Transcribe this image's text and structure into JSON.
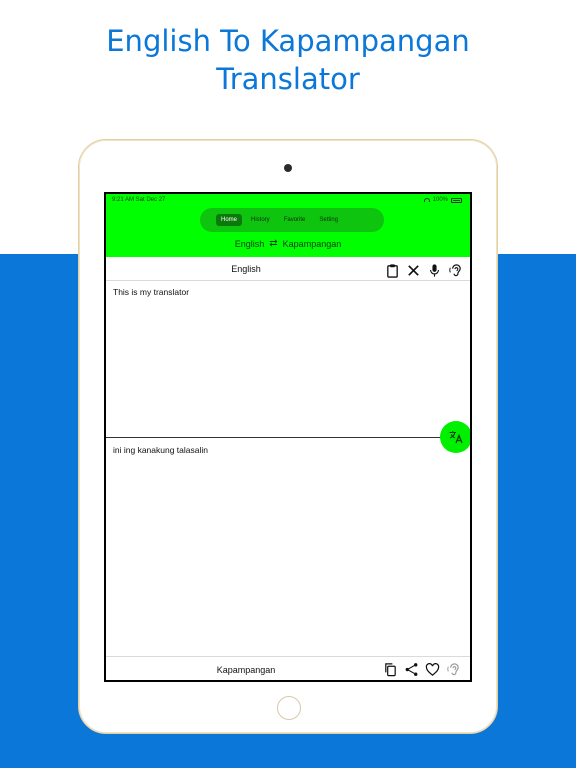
{
  "headline": {
    "line1": "English To Kapampangan",
    "line2": "Translator"
  },
  "status_bar": {
    "time_date": "9:21 AM   Sat Dec 27",
    "battery": "100%"
  },
  "nav_tabs": [
    {
      "label": "Home",
      "active": true
    },
    {
      "label": "History",
      "active": false
    },
    {
      "label": "Favorite",
      "active": false
    },
    {
      "label": "Setting",
      "active": false
    }
  ],
  "languages": {
    "source": "English",
    "swap_icon": "swap-arrows-icon",
    "target": "Kapampangan"
  },
  "source_panel": {
    "title": "English",
    "text": "This is my translator",
    "icons": [
      "clipboard-icon",
      "clear-icon",
      "microphone-icon",
      "ear-icon"
    ]
  },
  "translate_button": {
    "icon": "translate-icon"
  },
  "target_panel": {
    "title": "Kapampangan",
    "text": "ini ing kanakung talasalin",
    "icons": [
      "copy-icon",
      "share-icon",
      "heart-icon",
      "ear-icon"
    ]
  },
  "colors": {
    "accent_green": "#00ff00",
    "brand_blue": "#0a77d9"
  }
}
